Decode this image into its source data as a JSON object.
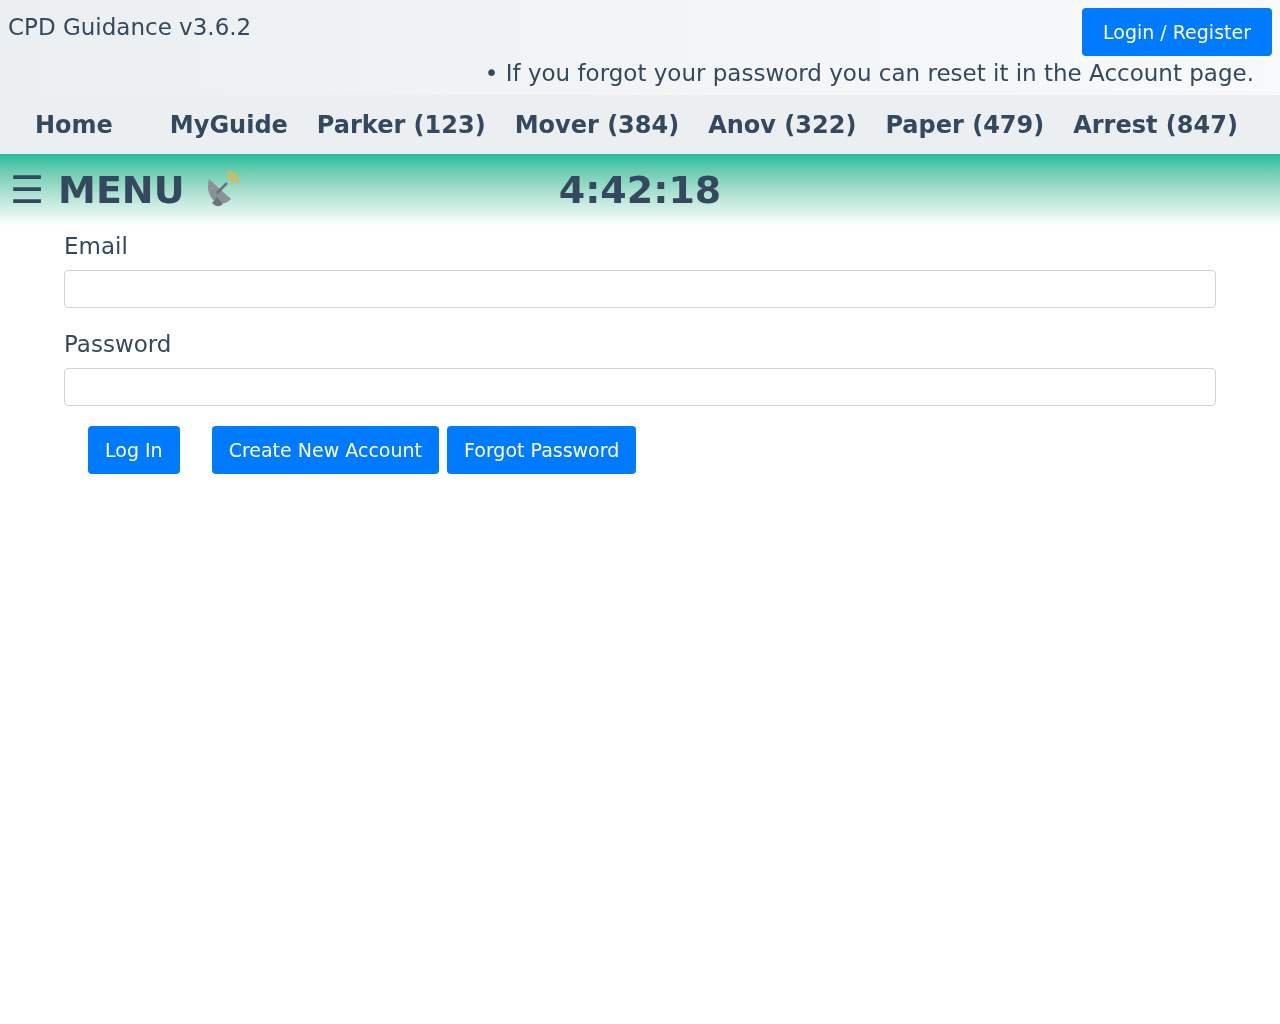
{
  "header": {
    "title": "CPD Guidance v3.6.2",
    "login_button": "Login / Register",
    "notice": "• If you forgot your password you can reset it in the Account page."
  },
  "nav": {
    "items": [
      {
        "label": "Home"
      },
      {
        "label": "MyGuide"
      },
      {
        "label": "Parker (123)"
      },
      {
        "label": "Mover (384)"
      },
      {
        "label": "Anov (322)"
      },
      {
        "label": "Paper (479)"
      },
      {
        "label": "Arrest (847)"
      }
    ]
  },
  "menu_bar": {
    "menu_icon": "☰",
    "menu_label": "MENU",
    "clock": "4:42:18"
  },
  "form": {
    "fields": [
      {
        "label": "Email"
      },
      {
        "label": "Password"
      }
    ],
    "buttons": [
      {
        "label": "Log In"
      },
      {
        "label": "Create New Account"
      },
      {
        "label": "Forgot Password"
      }
    ]
  }
}
